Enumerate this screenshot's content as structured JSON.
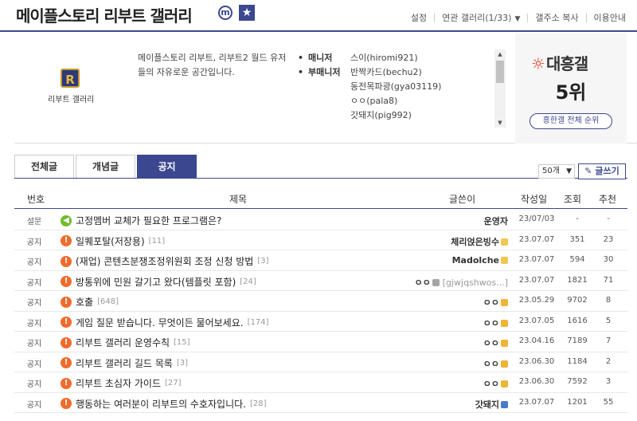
{
  "header": {
    "title": "메이플스토리 리부트 갤러리",
    "m_badge": "m",
    "links": [
      "설정",
      "연관 갤러리(1/33)",
      "갤주소 복사",
      "이용안내"
    ]
  },
  "info": {
    "logo_label": "리부트 갤러리",
    "description": "메이플스토리 리부트, 리부트2 월드 유저들의 자유로운 공간입니다.",
    "roles": [
      "매니저",
      "부매니저"
    ],
    "managers": [
      "스이(hiromi921)",
      "반짝카드(bechu2)",
      "동전목파광(gya03119)",
      "ㅇㅇ(pala8)",
      "갓돼지(pig992)"
    ]
  },
  "rank": {
    "brand": "대흥갤",
    "rank": "5위",
    "button": "흥한갤 전체 순위"
  },
  "tabs": [
    {
      "label": "전체글",
      "active": false
    },
    {
      "label": "개념글",
      "active": false
    },
    {
      "label": "공지",
      "active": true
    }
  ],
  "controls": {
    "count": "50개",
    "write": "글쓰기"
  },
  "columns": [
    "번호",
    "제목",
    "글쓴이",
    "작성일",
    "조회",
    "추천"
  ],
  "rows": [
    {
      "num": "설문",
      "icon": "speaker",
      "title": "고정멤버 교체가 필요한 프로그램은?",
      "count": "",
      "writer": "운영자",
      "badge": "",
      "date": "23/07/03",
      "views": "-",
      "recs": "-"
    },
    {
      "num": "공지",
      "icon": "bang",
      "title": "일퀘포탈(저장용)",
      "count": "[11]",
      "writer": "체리얹은빙수",
      "badge": "lock",
      "date": "23.07.07",
      "views": "351",
      "recs": "23"
    },
    {
      "num": "공지",
      "icon": "bang",
      "title": "(재업) 콘텐츠분쟁조정위원회 조정 신청 방법",
      "count": "[3]",
      "writer": "Madolche",
      "badge": "lock",
      "date": "23.07.07",
      "views": "594",
      "recs": "30"
    },
    {
      "num": "공지",
      "icon": "bang",
      "title": "방통위에 민원 갈기고 왔다(템플릿 포함)",
      "count": "[24]",
      "writer": "ㅇㅇ",
      "writer_extra": "[gjwjqshwos...]",
      "badge": "grey",
      "date": "23.07.07",
      "views": "1821",
      "recs": "71"
    },
    {
      "num": "공지",
      "icon": "bang",
      "title": "호출",
      "count": "[648]",
      "writer": "ㅇㅇ",
      "badge": "gold",
      "date": "23.05.29",
      "views": "9702",
      "recs": "8"
    },
    {
      "num": "공지",
      "icon": "bang",
      "title": "게임 질문 받습니다. 무엇이든 물어보세요.",
      "count": "[174]",
      "writer": "ㅇㅇ",
      "badge": "gold",
      "date": "23.07.05",
      "views": "1616",
      "recs": "5"
    },
    {
      "num": "공지",
      "icon": "bang",
      "title": "리부트 갤러리 운영수칙",
      "count": "[15]",
      "writer": "ㅇㅇ",
      "badge": "gold",
      "date": "23.04.16",
      "views": "7189",
      "recs": "7"
    },
    {
      "num": "공지",
      "icon": "bang",
      "title": "리부트 갤러리 길드 목록",
      "count": "[3]",
      "writer": "ㅇㅇ",
      "badge": "gold",
      "date": "23.06.30",
      "views": "1184",
      "recs": "2"
    },
    {
      "num": "공지",
      "icon": "bang",
      "title": "리부트 초심자 가이드",
      "count": "[27]",
      "writer": "ㅇㅇ",
      "badge": "gold",
      "date": "23.06.30",
      "views": "7592",
      "recs": "3"
    },
    {
      "num": "공지",
      "icon": "bang",
      "title": "행동하는 여러분이 리부트의 수호자입니다.",
      "count": "[28]",
      "writer": "갓돼지",
      "badge": "blue",
      "date": "23.07.07",
      "views": "1201",
      "recs": "55"
    }
  ]
}
